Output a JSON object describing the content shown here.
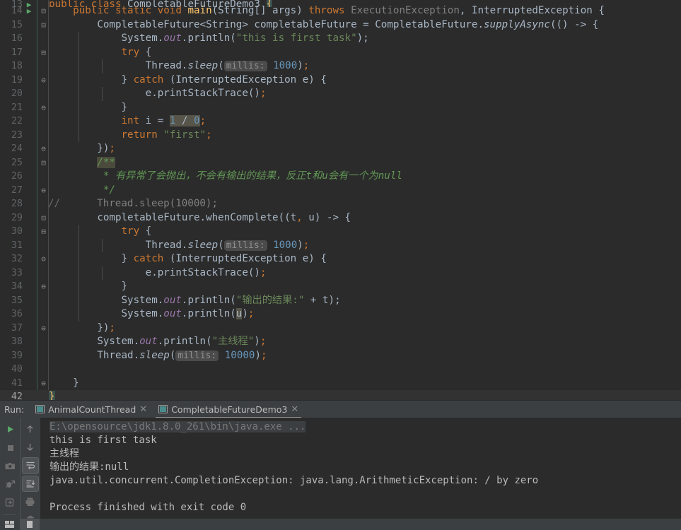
{
  "editor": {
    "language": "java",
    "theme": "darcula",
    "colors": {
      "background": "#2b2b2b",
      "keyword": "#cc7832",
      "string": "#6a8759",
      "number": "#6897bb",
      "field": "#9876aa",
      "comment": "#629755",
      "text": "#a9b7c6",
      "line_number": "#606366",
      "current_line": "#323232",
      "run_marker": "#59a869"
    },
    "lines": [
      {
        "num": "13",
        "partial": true,
        "runmark": "▶"
      },
      {
        "num": "14",
        "runmark": "▶",
        "fold": "—"
      },
      {
        "num": "15",
        "fold": "—"
      },
      {
        "num": "16"
      },
      {
        "num": "17",
        "fold": "—"
      },
      {
        "num": "18"
      },
      {
        "num": "19",
        "fold": "—"
      },
      {
        "num": "20"
      },
      {
        "num": "21",
        "fold": "—"
      },
      {
        "num": "22"
      },
      {
        "num": "23"
      },
      {
        "num": "24",
        "fold": "—"
      },
      {
        "num": "25",
        "fold": "—"
      },
      {
        "num": "26"
      },
      {
        "num": "27",
        "fold": "—"
      },
      {
        "num": "28",
        "gutter_comment": "//"
      },
      {
        "num": "29",
        "fold": "—"
      },
      {
        "num": "30",
        "fold": "—"
      },
      {
        "num": "31"
      },
      {
        "num": "32",
        "fold": "—"
      },
      {
        "num": "33"
      },
      {
        "num": "34",
        "fold": "—"
      },
      {
        "num": "35"
      },
      {
        "num": "36"
      },
      {
        "num": "37",
        "fold": "—"
      },
      {
        "num": "38"
      },
      {
        "num": "39"
      },
      {
        "num": "40"
      },
      {
        "num": "41",
        "fold": "—"
      },
      {
        "num": "42",
        "current": true
      }
    ],
    "source_text": [
      "public class CompletableFutureDemo3 {",
      "    public static void main(String[] args) throws ExecutionException, InterruptedException {",
      "        CompletableFuture<String> completableFuture = CompletableFuture.supplyAsync(() -> {",
      "            System.out.println(\"this is first task\");",
      "            try {",
      "                Thread.sleep( millis: 1000);",
      "            } catch (InterruptedException e) {",
      "                e.printStackTrace();",
      "            }",
      "            int i = 1 / 0;",
      "            return \"first\";",
      "        });",
      "        /**",
      "         * 有异常了会抛出，不会有输出的结果，反正t和u会有一个为null",
      "         */",
      "//        Thread.sleep(10000);",
      "        completableFuture.whenComplete((t, u) -> {",
      "            try {",
      "                Thread.sleep( millis: 1000);",
      "            } catch (InterruptedException e) {",
      "                e.printStackTrace();",
      "            }",
      "            System.out.println(\"输出的结果:\" + t);",
      "            System.out.println(u);",
      "        });",
      "        System.out.println(\"主线程\");",
      "        Thread.sleep( millis: 10000);",
      "",
      "    }",
      "}"
    ],
    "inlay_hints": [
      "millis:",
      "millis:",
      "millis:"
    ],
    "highlighted_tokens": [
      "1 / 0",
      "u",
      "/**",
      "}"
    ]
  },
  "run_window": {
    "label": "Run:",
    "tabs": [
      {
        "label": "AnimalCountThread",
        "active": false,
        "close": "✕",
        "icon": "run-config-icon"
      },
      {
        "label": "CompletableFutureDemo3",
        "active": true,
        "close": "✕",
        "icon": "run-config-icon"
      }
    ],
    "toolbar_left": [
      {
        "name": "rerun-button",
        "icon": "play-icon"
      },
      {
        "name": "stop-button",
        "icon": "stop-icon"
      },
      {
        "name": "thread-dump-button",
        "icon": "camera-icon"
      },
      {
        "name": "restart-debug-button",
        "icon": "bug-arrow-icon"
      },
      {
        "name": "attach-console-button",
        "icon": "export-arrow-icon"
      }
    ],
    "toolbar_right": [
      {
        "name": "up-stacktrace-button",
        "icon": "arrow-up-icon",
        "active": false
      },
      {
        "name": "down-stacktrace-button",
        "icon": "arrow-down-icon",
        "active": false
      },
      {
        "name": "soft-wrap-button",
        "icon": "soft-wrap-icon",
        "active": true
      },
      {
        "name": "scroll-to-end-button",
        "icon": "scroll-end-icon",
        "active": true
      },
      {
        "name": "print-button",
        "icon": "printer-icon",
        "active": false
      },
      {
        "name": "clear-all-button",
        "icon": "trash-icon",
        "active": false
      }
    ],
    "console": [
      {
        "text": "E:\\opensource\\jdk1.8.0_261\\bin\\java.exe ...",
        "kind": "command"
      },
      {
        "text": "this is first task",
        "kind": "stdout"
      },
      {
        "text": "主线程",
        "kind": "stdout"
      },
      {
        "text": "输出的结果:null",
        "kind": "stdout"
      },
      {
        "text": "java.util.concurrent.CompletionException: java.lang.ArithmeticException: / by zero",
        "kind": "stdout"
      },
      {
        "text": "",
        "kind": "blank"
      },
      {
        "text": "Process finished with exit code 0",
        "kind": "stdout"
      }
    ]
  },
  "status_bar": {
    "buttons": [
      {
        "name": "toggle-tool-window-bars-button",
        "icon": "layout-icon",
        "selected": false
      },
      {
        "name": "run-tool-window-button",
        "icon": "panel-icon",
        "selected": true
      }
    ]
  }
}
